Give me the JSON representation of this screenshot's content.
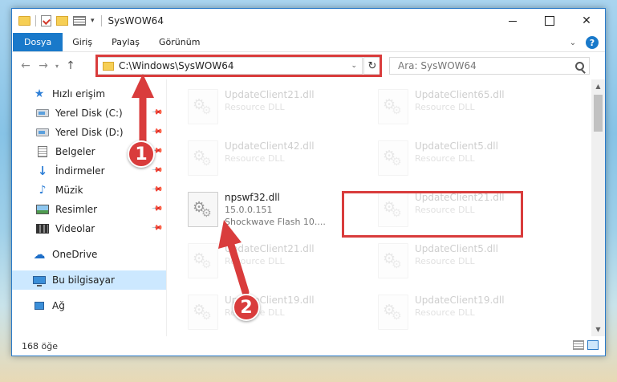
{
  "window": {
    "title": "SysWOW64"
  },
  "ribbon": {
    "tabs": [
      "Dosya",
      "Giriş",
      "Paylaş",
      "Görünüm"
    ],
    "help": "?"
  },
  "address": {
    "path": "C:\\Windows\\SysWOW64",
    "search_placeholder": "Ara: SysWOW64"
  },
  "sidebar": {
    "items": [
      {
        "label": "Hızlı erişim",
        "icon": "star-icon"
      },
      {
        "label": "Yerel Disk (C:)",
        "icon": "drive-icon",
        "pinned": true
      },
      {
        "label": "Yerel Disk (D:)",
        "icon": "drive-icon",
        "pinned": true
      },
      {
        "label": "Belgeler",
        "icon": "documents-icon",
        "pinned": true
      },
      {
        "label": "İndirmeler",
        "icon": "downloads-icon",
        "pinned": true
      },
      {
        "label": "Müzik",
        "icon": "music-icon",
        "pinned": true
      },
      {
        "label": "Resimler",
        "icon": "pictures-icon",
        "pinned": true
      },
      {
        "label": "Videolar",
        "icon": "videos-icon",
        "pinned": true
      },
      {
        "label": "OneDrive",
        "icon": "cloud-icon"
      },
      {
        "label": "Bu bilgisayar",
        "icon": "computer-icon",
        "selected": true
      },
      {
        "label": "Ağ",
        "icon": "network-icon"
      }
    ]
  },
  "files": [
    {
      "name": "UpdateClient21.dll",
      "sub": "Resource DLL"
    },
    {
      "name": "UpdateClient65.dll",
      "sub": "Resource DLL"
    },
    {
      "name": "UpdateClient42.dll",
      "sub": "Resource DLL"
    },
    {
      "name": "UpdateClient5.dll",
      "sub": "Resource DLL"
    },
    {
      "name": "npswf32.dll",
      "sub": "15.0.0.151",
      "sub2": "Shockwave Flash 10....",
      "highlight": true
    },
    {
      "name": "UpdateClient21.dll",
      "sub": "Resource DLL"
    },
    {
      "name": "UpdateClient21.dll",
      "sub": "Resource DLL"
    },
    {
      "name": "UpdateClient5.dll",
      "sub": "Resource DLL"
    },
    {
      "name": "UpdateClient19.dll",
      "sub": "Resource DLL"
    },
    {
      "name": "UpdateClient19.dll",
      "sub": "Resource DLL"
    }
  ],
  "status": {
    "count": "168 öğe"
  },
  "annotations": {
    "step1": "1",
    "step2": "2",
    "color": "#d93c3c"
  }
}
